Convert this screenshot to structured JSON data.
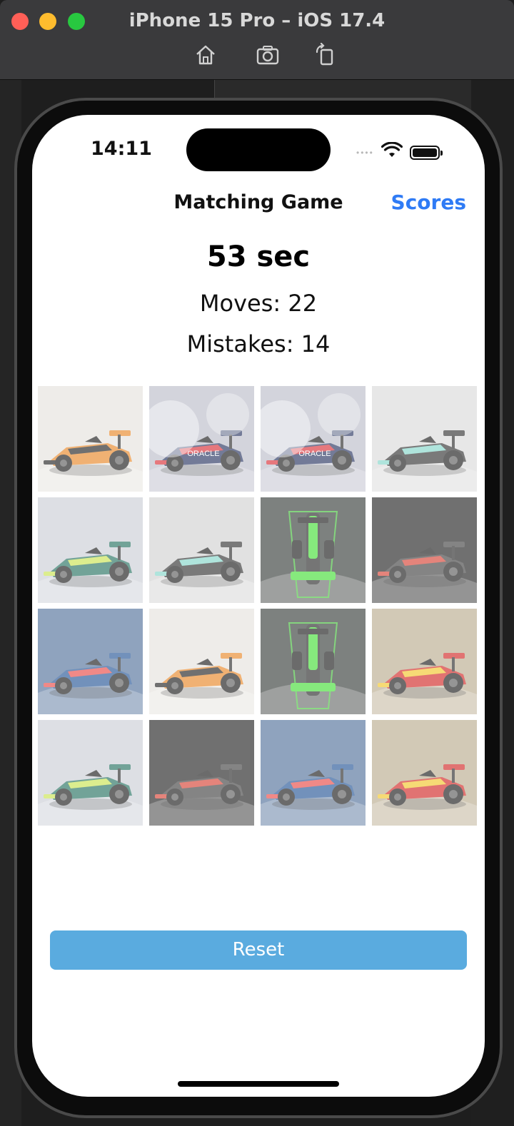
{
  "simulator": {
    "title": "iPhone 15 Pro – iOS 17.4",
    "tools": [
      "home-icon",
      "screenshot-icon",
      "rotate-icon"
    ]
  },
  "status_bar": {
    "time": "14:11",
    "signal_dots": "••••"
  },
  "nav": {
    "title": "Matching Game",
    "action": "Scores"
  },
  "stats": {
    "timer": "53 sec",
    "moves": "Moves: 22",
    "mistakes": "Mistakes: 14"
  },
  "cards": [
    {
      "car": "mclaren",
      "body": "#e8831f",
      "accent": "#1a1a1a",
      "bg": "#e5e2dc"
    },
    {
      "car": "redbull",
      "body": "#1e2c5a",
      "accent": "#d7262e",
      "bg": "#b9bac8",
      "label": "ORACLE"
    },
    {
      "car": "redbull",
      "body": "#1e2c5a",
      "accent": "#d7262e",
      "bg": "#b9bac8",
      "label": "ORACLE"
    },
    {
      "car": "mercedes",
      "body": "#2a2a2a",
      "accent": "#7fd4c8",
      "bg": "#d9d9d9"
    },
    {
      "car": "astonmartin",
      "body": "#1d6b5a",
      "accent": "#c8e34a",
      "bg": "#c9cdd4"
    },
    {
      "car": "mercedes",
      "body": "#2a2a2a",
      "accent": "#7fd4c8",
      "bg": "#d0d0d0"
    },
    {
      "car": "sauber",
      "body": "#222222",
      "accent": "#3ddc2f",
      "bg": "#2f3532"
    },
    {
      "car": "haas",
      "body": "#3a3a3a",
      "accent": "#d43a2c",
      "bg": "#1a1a1a"
    },
    {
      "car": "alpine",
      "body": "#1d4f93",
      "accent": "#e8423f",
      "bg": "#4b6b97"
    },
    {
      "car": "mclaren",
      "body": "#e8831f",
      "accent": "#1a1a1a",
      "bg": "#e5e2dc"
    },
    {
      "car": "sauber",
      "body": "#222222",
      "accent": "#3ddc2f",
      "bg": "#2f3532"
    },
    {
      "car": "ferrari",
      "body": "#cf1f1c",
      "accent": "#f2c522",
      "bg": "#b7a98a"
    },
    {
      "car": "astonmartin",
      "body": "#1d6b5a",
      "accent": "#c8e34a",
      "bg": "#c9cdd4"
    },
    {
      "car": "haas",
      "body": "#3a3a3a",
      "accent": "#d43a2c",
      "bg": "#1a1a1a"
    },
    {
      "car": "alpine",
      "body": "#1d4f93",
      "accent": "#e8423f",
      "bg": "#4b6b97"
    },
    {
      "car": "ferrari",
      "body": "#cf1f1c",
      "accent": "#f2c522",
      "bg": "#b7a98a"
    }
  ],
  "reset_label": "Reset",
  "colors": {
    "accent": "#2f7bf5",
    "reset_button": "#5aabdf"
  }
}
